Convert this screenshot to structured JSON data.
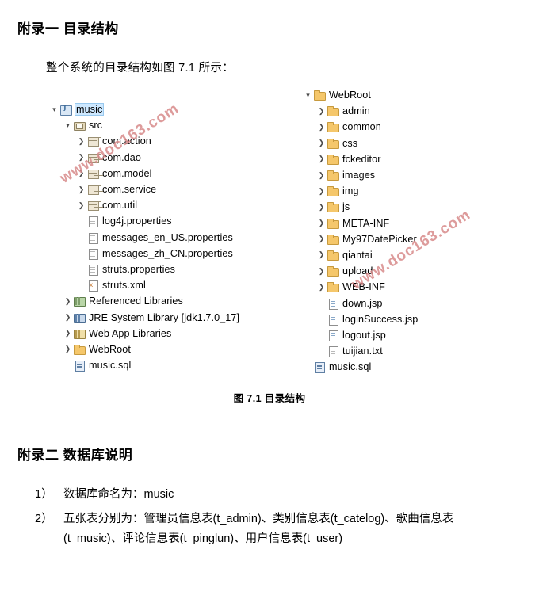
{
  "appendix1": {
    "title": "附录一 目录结构",
    "intro": "整个系统的目录结构如图 7.1 所示：",
    "figure_caption": "图 7.1 目录结构"
  },
  "appendix2": {
    "title": "附录二 数据库说明",
    "items": [
      {
        "num": "1）",
        "text": "数据库命名为：music"
      },
      {
        "num": "2）",
        "text": "五张表分别为：管理员信息表(t_admin)、类别信息表(t_catelog)、歌曲信息表(t_music)、评论信息表(t_pinglun)、用户信息表(t_user)"
      }
    ]
  },
  "tree": {
    "left": [
      {
        "label": "music",
        "indent": 0,
        "arrow": "down",
        "icon": "project",
        "highlight": true
      },
      {
        "label": "src",
        "indent": 1,
        "arrow": "down",
        "icon": "src",
        "highlight": false
      },
      {
        "label": "com.action",
        "indent": 2,
        "arrow": "right",
        "icon": "pkg",
        "highlight": false
      },
      {
        "label": "com.dao",
        "indent": 2,
        "arrow": "right",
        "icon": "pkg",
        "highlight": false
      },
      {
        "label": "com.model",
        "indent": 2,
        "arrow": "right",
        "icon": "pkg",
        "highlight": false
      },
      {
        "label": "com.service",
        "indent": 2,
        "arrow": "right",
        "icon": "pkg",
        "highlight": false
      },
      {
        "label": "com.util",
        "indent": 2,
        "arrow": "right",
        "icon": "pkg",
        "highlight": false
      },
      {
        "label": "log4j.properties",
        "indent": 2,
        "arrow": "none",
        "icon": "file",
        "highlight": false
      },
      {
        "label": "messages_en_US.properties",
        "indent": 2,
        "arrow": "none",
        "icon": "file",
        "highlight": false
      },
      {
        "label": "messages_zh_CN.properties",
        "indent": 2,
        "arrow": "none",
        "icon": "file",
        "highlight": false
      },
      {
        "label": "struts.properties",
        "indent": 2,
        "arrow": "none",
        "icon": "file",
        "highlight": false
      },
      {
        "label": "struts.xml",
        "indent": 2,
        "arrow": "none",
        "icon": "xml",
        "highlight": false
      },
      {
        "label": "Referenced Libraries",
        "indent": 1,
        "arrow": "right",
        "icon": "lib",
        "highlight": false
      },
      {
        "label": "JRE System Library [jdk1.7.0_17]",
        "indent": 1,
        "arrow": "right",
        "icon": "jre",
        "highlight": false
      },
      {
        "label": "Web App Libraries",
        "indent": 1,
        "arrow": "right",
        "icon": "weblib",
        "highlight": false
      },
      {
        "label": "WebRoot",
        "indent": 1,
        "arrow": "right",
        "icon": "folder",
        "highlight": false
      },
      {
        "label": "music.sql",
        "indent": 1,
        "arrow": "none",
        "icon": "sql",
        "highlight": false
      }
    ],
    "right": [
      {
        "label": "WebRoot",
        "indent": 0,
        "arrow": "down",
        "icon": "folder",
        "highlight": false
      },
      {
        "label": "admin",
        "indent": 1,
        "arrow": "right",
        "icon": "folder",
        "highlight": false
      },
      {
        "label": "common",
        "indent": 1,
        "arrow": "right",
        "icon": "folder",
        "highlight": false
      },
      {
        "label": "css",
        "indent": 1,
        "arrow": "right",
        "icon": "folder",
        "highlight": false
      },
      {
        "label": "fckeditor",
        "indent": 1,
        "arrow": "right",
        "icon": "folder",
        "highlight": false
      },
      {
        "label": "images",
        "indent": 1,
        "arrow": "right",
        "icon": "folder",
        "highlight": false
      },
      {
        "label": "img",
        "indent": 1,
        "arrow": "right",
        "icon": "folder",
        "highlight": false
      },
      {
        "label": "js",
        "indent": 1,
        "arrow": "right",
        "icon": "folder",
        "highlight": false
      },
      {
        "label": "META-INF",
        "indent": 1,
        "arrow": "right",
        "icon": "metafolder",
        "highlight": false
      },
      {
        "label": "My97DatePicker",
        "indent": 1,
        "arrow": "right",
        "icon": "folder",
        "highlight": false
      },
      {
        "label": "qiantai",
        "indent": 1,
        "arrow": "right",
        "icon": "folder",
        "highlight": false
      },
      {
        "label": "upload",
        "indent": 1,
        "arrow": "right",
        "icon": "folder",
        "highlight": false
      },
      {
        "label": "WEB-INF",
        "indent": 1,
        "arrow": "right",
        "icon": "metafolder",
        "highlight": false
      },
      {
        "label": "down.jsp",
        "indent": 1,
        "arrow": "none",
        "icon": "jsp",
        "highlight": false
      },
      {
        "label": "loginSuccess.jsp",
        "indent": 1,
        "arrow": "none",
        "icon": "jsp",
        "highlight": false
      },
      {
        "label": "logout.jsp",
        "indent": 1,
        "arrow": "none",
        "icon": "jsp",
        "highlight": false
      },
      {
        "label": "tuijian.txt",
        "indent": 1,
        "arrow": "none",
        "icon": "file",
        "highlight": false
      },
      {
        "label": "music.sql",
        "indent": 0,
        "arrow": "none",
        "icon": "sql",
        "highlight": false
      }
    ]
  },
  "watermarks": {
    "text1": "www.doc163.com",
    "text2": "www.doc163.com",
    "color": "#d88a8a"
  }
}
